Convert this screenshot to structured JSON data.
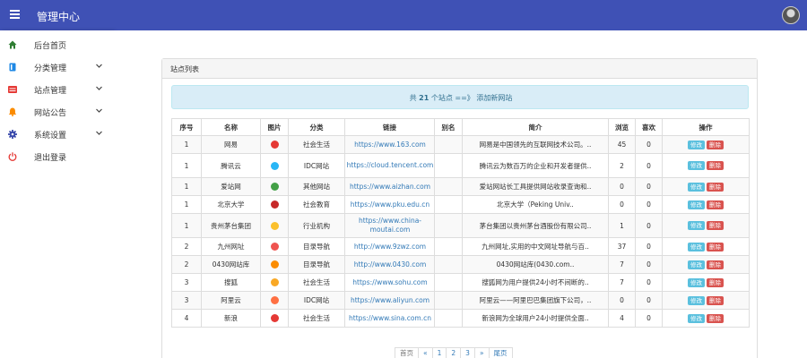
{
  "header": {
    "title": "管理中心",
    "menu_icon": "hamburger-icon",
    "avatar_icon": "user-avatar"
  },
  "sidebar": {
    "items": [
      {
        "label": "后台首页",
        "icon": "home-icon",
        "color": "#2e7d32",
        "has_chevron": false
      },
      {
        "label": "分类管理",
        "icon": "book-icon",
        "color": "#1e88e5",
        "has_chevron": true
      },
      {
        "label": "站点管理",
        "icon": "table-icon",
        "color": "#e53935",
        "has_chevron": true
      },
      {
        "label": "网站公告",
        "icon": "bell-icon",
        "color": "#fb8c00",
        "has_chevron": true
      },
      {
        "label": "系统设置",
        "icon": "gear-icon",
        "color": "#3949ab",
        "has_chevron": true
      },
      {
        "label": "退出登录",
        "icon": "power-icon",
        "color": "#e53935",
        "has_chevron": false
      }
    ]
  },
  "panel": {
    "title": "站点列表",
    "info": {
      "prefix": "共",
      "count": "21",
      "suffix": "个站点 ==》",
      "link": "添加新网站"
    }
  },
  "table": {
    "headers": [
      "序号",
      "名称",
      "图片",
      "分类",
      "链接",
      "别名",
      "简介",
      "浏览",
      "喜欢",
      "操作"
    ],
    "edit_label": "修改",
    "delete_label": "删除",
    "rows": [
      {
        "seq": "1",
        "name": "网易",
        "icon": "netease-icon",
        "icon_color": "#e53935",
        "category": "社会生活",
        "url": "https://www.163.com",
        "alias": "",
        "desc": "网易是中国领先的互联网技术公司。..",
        "views": "45",
        "likes": "0"
      },
      {
        "seq": "1",
        "name": "腾讯云",
        "icon": "tencent-cloud-icon",
        "icon_color": "#29b6f6",
        "category": "IDC网站",
        "url": "https://cloud.tencent.com",
        "alias": "",
        "desc": "腾讯云为数百万的企业和开发者提供..",
        "views": "2",
        "likes": "0"
      },
      {
        "seq": "1",
        "name": "爱站网",
        "icon": "aizhan-icon",
        "icon_color": "#43a047",
        "category": "其他网站",
        "url": "https://www.aizhan.com",
        "alias": "",
        "desc": "爱站网站长工具提供网站收录查询和..",
        "views": "0",
        "likes": "0"
      },
      {
        "seq": "1",
        "name": "北京大学",
        "icon": "pku-icon",
        "icon_color": "#c62828",
        "category": "社会教育",
        "url": "https://www.pku.edu.cn",
        "alias": "",
        "desc": "北京大学（Peking Univ..",
        "views": "0",
        "likes": "0"
      },
      {
        "seq": "1",
        "name": "贵州茅台集团",
        "icon": "moutai-icon",
        "icon_color": "#fbc02d",
        "category": "行业机构",
        "url": "https://www.china-moutai.com",
        "alias": "",
        "desc": "茅台集团以贵州茅台酒股份有限公司..",
        "views": "1",
        "likes": "0"
      },
      {
        "seq": "2",
        "name": "九州网址",
        "icon": "9zwz-icon",
        "icon_color": "#ef5350",
        "category": "目录导航",
        "url": "http://www.9zwz.com",
        "alias": "",
        "desc": "九州网址,实用的中文网址导航与百..",
        "views": "37",
        "likes": "0"
      },
      {
        "seq": "2",
        "name": "0430网站库",
        "icon": "0430-icon",
        "icon_color": "#fb8c00",
        "category": "目录导航",
        "url": "http://www.0430.com",
        "alias": "",
        "desc": "0430网站库(0430.com..",
        "views": "7",
        "likes": "0"
      },
      {
        "seq": "3",
        "name": "搜狐",
        "icon": "sohu-icon",
        "icon_color": "#f9a825",
        "category": "社会生活",
        "url": "https://www.sohu.com",
        "alias": "",
        "desc": "搜狐网为用户提供24小时不间断的..",
        "views": "7",
        "likes": "0"
      },
      {
        "seq": "3",
        "name": "阿里云",
        "icon": "aliyun-icon",
        "icon_color": "#ff7043",
        "category": "IDC网站",
        "url": "https://www.aliyun.com",
        "alias": "",
        "desc": "阿里云——阿里巴巴集团旗下公司，..",
        "views": "0",
        "likes": "0"
      },
      {
        "seq": "4",
        "name": "新浪",
        "icon": "sina-icon",
        "icon_color": "#e53935",
        "category": "社会生活",
        "url": "https://www.sina.com.cn",
        "alias": "",
        "desc": "新浪网为全球用户24小时提供全面..",
        "views": "4",
        "likes": "0"
      }
    ]
  },
  "pagination": {
    "items": [
      "首页",
      "«",
      "1",
      "2",
      "3",
      "»",
      "尾页"
    ]
  }
}
